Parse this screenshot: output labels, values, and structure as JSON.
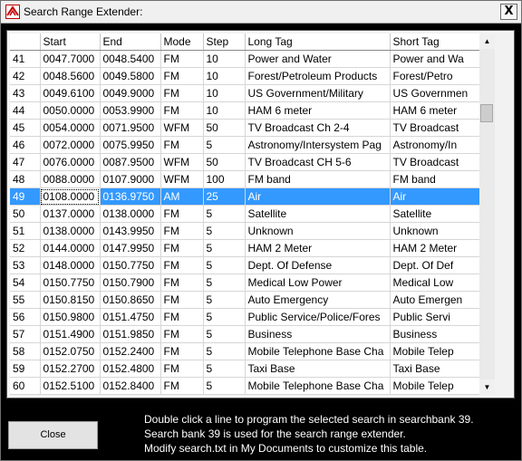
{
  "window": {
    "title": "Search Range Extender:",
    "close_glyph": "X"
  },
  "icons": {
    "app": "app-icon",
    "close": "close-icon",
    "scroll_up": "arrow-up-icon",
    "scroll_down": "arrow-down-icon"
  },
  "scrollbar": {
    "up_glyph": "▲",
    "down_glyph": "▼"
  },
  "table": {
    "columns": [
      "",
      "Start",
      "End",
      "Mode",
      "Step",
      "Long Tag",
      "Short Tag"
    ],
    "selected_row": "49",
    "rows": [
      [
        "41",
        "0047.7000",
        "0048.5400",
        "FM",
        "10",
        "Power and Water",
        "Power and Wa"
      ],
      [
        "42",
        "0048.5600",
        "0049.5800",
        "FM",
        "10",
        "Forest/Petroleum Products",
        "Forest/Petro"
      ],
      [
        "43",
        "0049.6100",
        "0049.9000",
        "FM",
        "10",
        "US Government/Military",
        "US Governmen"
      ],
      [
        "44",
        "0050.0000",
        "0053.9900",
        "FM",
        "10",
        "HAM 6 meter",
        "HAM 6 meter"
      ],
      [
        "45",
        "0054.0000",
        "0071.9500",
        "WFM",
        "50",
        "TV Broadcast Ch 2-4",
        "TV Broadcast"
      ],
      [
        "46",
        "0072.0000",
        "0075.9950",
        "FM",
        "5",
        "Astronomy/Intersystem Pag",
        "Astronomy/In"
      ],
      [
        "47",
        "0076.0000",
        "0087.9500",
        "WFM",
        "50",
        "TV Broadcast CH 5-6",
        "TV Broadcast"
      ],
      [
        "48",
        "0088.0000",
        "0107.9000",
        "WFM",
        "100",
        "FM band",
        "FM band"
      ],
      [
        "49",
        "0108.0000",
        "0136.9750",
        "AM",
        "25",
        "Air",
        "Air"
      ],
      [
        "50",
        "0137.0000",
        "0138.0000",
        "FM",
        "5",
        "Satellite",
        "Satellite"
      ],
      [
        "51",
        "0138.0000",
        "0143.9950",
        "FM",
        "5",
        "Unknown",
        "Unknown"
      ],
      [
        "52",
        "0144.0000",
        "0147.9950",
        "FM",
        "5",
        "HAM 2 Meter",
        "HAM 2 Meter"
      ],
      [
        "53",
        "0148.0000",
        "0150.7750",
        "FM",
        "5",
        "Dept. Of Defense",
        "Dept. Of Def"
      ],
      [
        "54",
        "0150.7750",
        "0150.7900",
        "FM",
        "5",
        "Medical Low Power",
        "Medical Low"
      ],
      [
        "55",
        "0150.8150",
        "0150.8650",
        "FM",
        "5",
        "Auto Emergency",
        "Auto Emergen"
      ],
      [
        "56",
        "0150.9800",
        "0151.4750",
        "FM",
        "5",
        "Public Service/Police/Fores",
        "Public Servi"
      ],
      [
        "57",
        "0151.4900",
        "0151.9850",
        "FM",
        "5",
        "Business",
        "Business"
      ],
      [
        "58",
        "0152.0750",
        "0152.2400",
        "FM",
        "5",
        "Mobile Telephone Base Cha",
        "Mobile Telep"
      ],
      [
        "59",
        "0152.2700",
        "0152.4800",
        "FM",
        "5",
        "Taxi Base",
        "Taxi Base"
      ],
      [
        "60",
        "0152.5100",
        "0152.8400",
        "FM",
        "5",
        "Mobile Telephone Base Cha",
        "Mobile Telep"
      ]
    ]
  },
  "buttons": {
    "close": "Close"
  },
  "info": [
    "Double click a line to program the selected search in searchbank 39.",
    "Search bank 39 is used for the search range extender.",
    "Modify search.txt in My Documents to customize this table."
  ],
  "colors": {
    "selection": "#3399ff",
    "background": "#000000",
    "info_text": "#ffffff"
  }
}
